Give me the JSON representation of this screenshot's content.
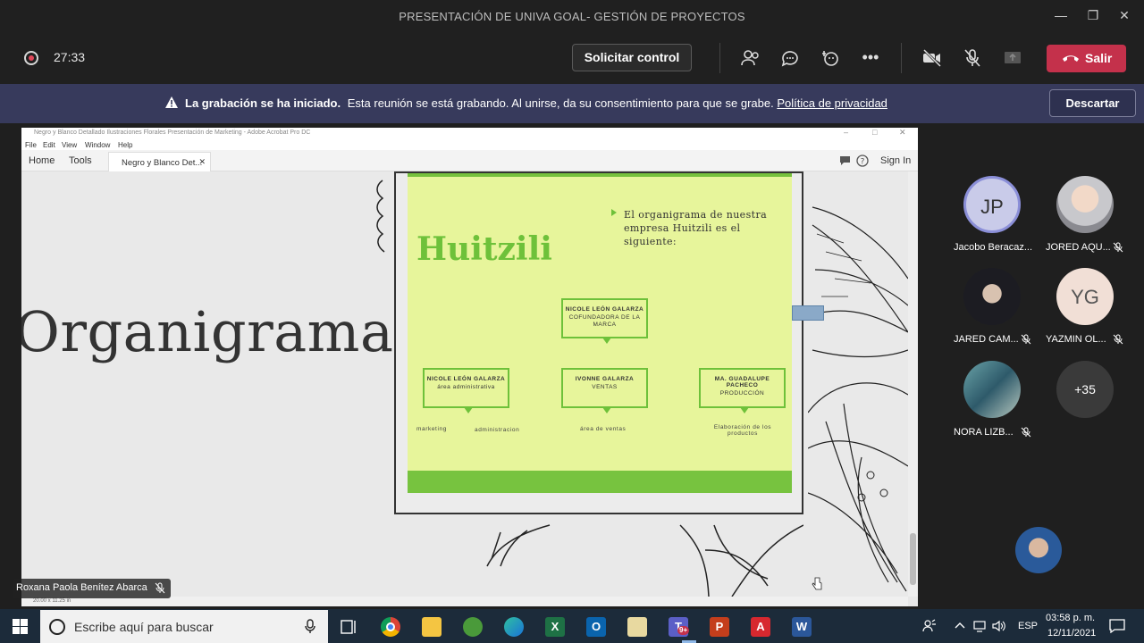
{
  "window": {
    "title": "PRESENTACIÓN DE UNIVA GOAL- GESTIÓN DE PROYECTOS"
  },
  "controls": {
    "timer": "27:33",
    "request_control_label": "Solicitar control",
    "exit_label": "Salir",
    "exit_color": "#c4314b"
  },
  "banner": {
    "bold": "La grabación se ha iniciado.",
    "text": "Esta reunión se está grabando. Al unirse, da su consentimiento para que se grabe.",
    "link": "Política de privacidad",
    "dismiss_label": "Descartar",
    "bg_color": "#373a5c"
  },
  "acrobat": {
    "title": "Negro y Blanco Detallado Ilustraciones Florales Presentación de Marketing - Adobe Acrobat Pro DC",
    "menu": [
      "File",
      "Edit",
      "View",
      "Window",
      "Help"
    ],
    "tabs": [
      "Home",
      "Tools"
    ],
    "doc_tab": "Negro y Blanco Det...",
    "sign_in": "Sign In",
    "page_size": "20.00 x 11.25 in"
  },
  "slide": {
    "left_title": "Organigrama",
    "brand": "Huitzili",
    "intro": "El organigrama de nuestra empresa Huitzili es el siguiente:",
    "top_box": {
      "name": "NICOLE LEÓN GALARZA",
      "role": "COFUNDADORA DE LA MARCA"
    },
    "boxes": [
      {
        "name": "NICOLE LEÓN GALARZA",
        "role": "área administrativa"
      },
      {
        "name": "IVONNE GALARZA",
        "role": "VENTAS"
      },
      {
        "name": "MA. GUADALUPE PACHECO",
        "role": "PRODUCCIÓN"
      }
    ],
    "sub_labels": [
      "marketing",
      "administracion",
      "área de ventas",
      "Elaboración de los productos"
    ],
    "accent": "#6ec13a",
    "bg": "#e7f59b"
  },
  "presenter": {
    "name": "Roxana Paola Benítez Abarca"
  },
  "participants": [
    {
      "name": "Jacobo Beracaz...",
      "initials": "JP",
      "muted": false
    },
    {
      "name": "JORED AQU...",
      "initials": "",
      "muted": true
    },
    {
      "name": "JARED CAM...",
      "initials": "",
      "muted": true
    },
    {
      "name": "YAZMIN OL...",
      "initials": "YG",
      "muted": true
    },
    {
      "name": "NORA LIZB...",
      "initials": "",
      "muted": true
    }
  ],
  "more_participants": "+35",
  "taskbar": {
    "search_placeholder": "Escribe aquí para buscar",
    "lang": "ESP",
    "time": "03:58 p. m.",
    "date": "12/11/2021",
    "teams_badge": "9+"
  }
}
